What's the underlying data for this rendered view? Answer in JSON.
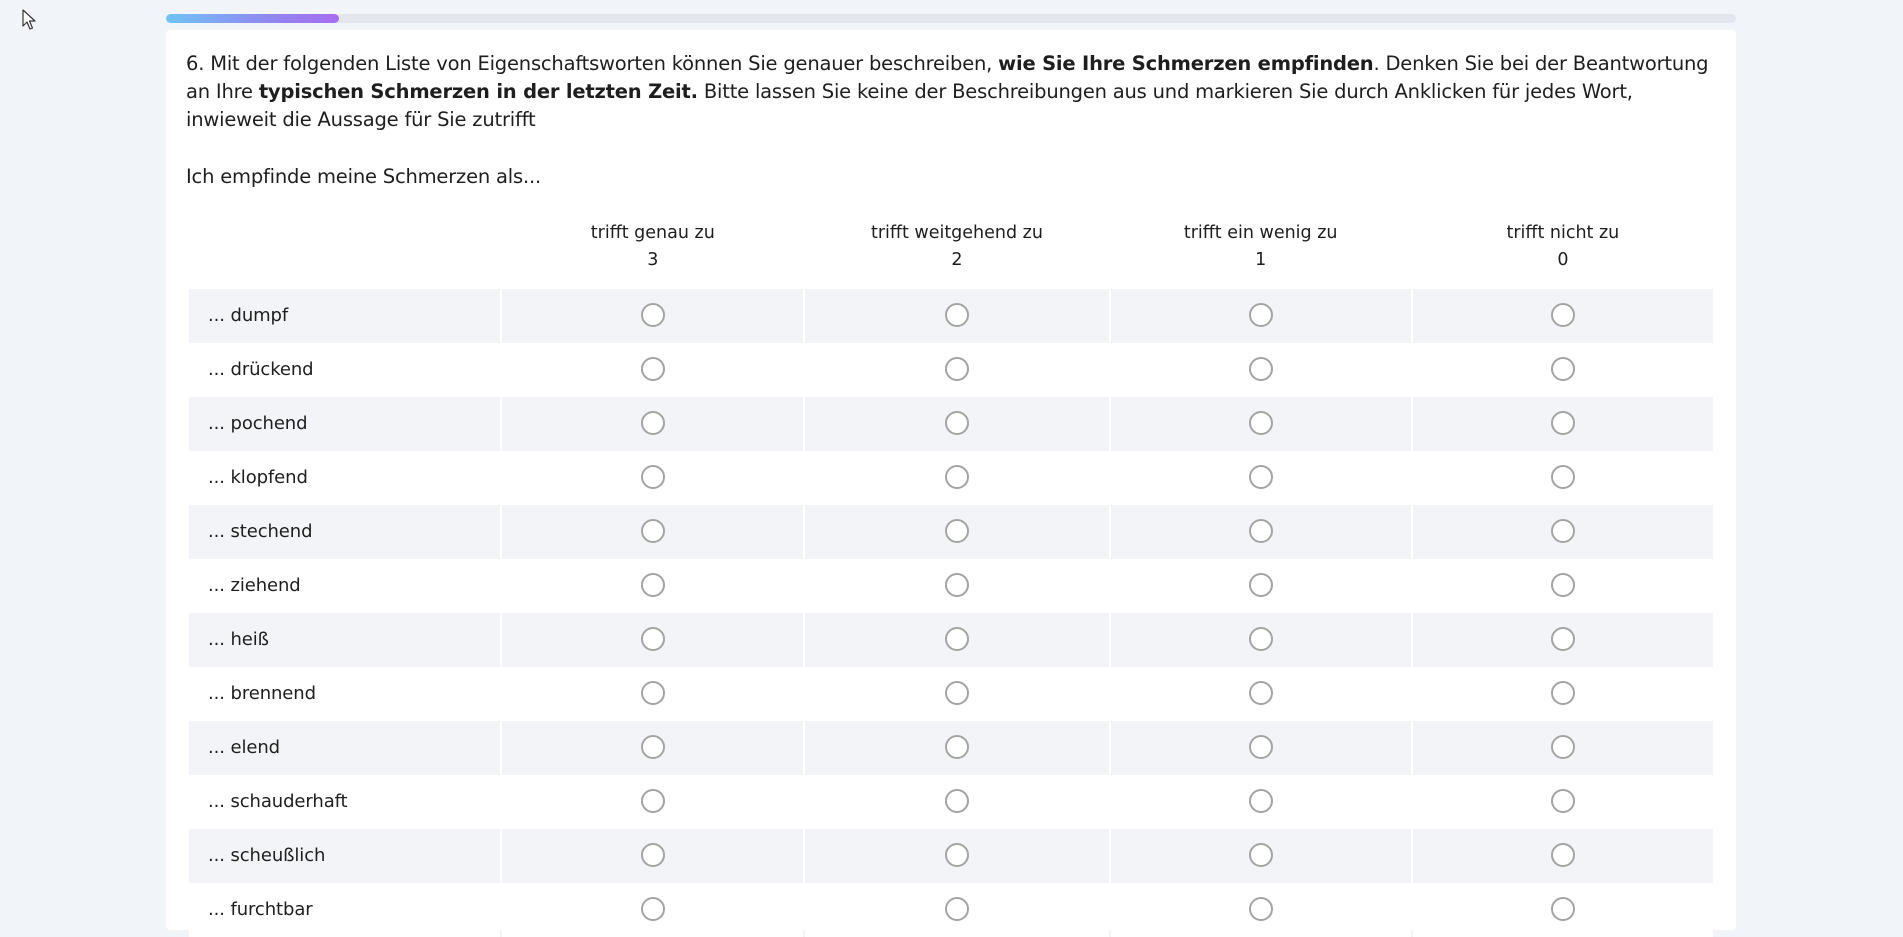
{
  "progress": {
    "percent": 11
  },
  "question": {
    "part1": "6. Mit der folgenden Liste von Eigenschaftsworten können Sie genauer beschreiben, ",
    "bold1": "wie Sie Ihre Schmerzen empfinden",
    "part2": ". Denken Sie bei der Beantwortung an Ihre ",
    "bold2": "typischen Schmerzen in der letzten Zeit.",
    "part3": " Bitte lassen Sie keine der Beschreibungen aus und markieren Sie durch Anklicken für jedes Wort, inwieweit die Aussage für Sie zutrifft",
    "lead": "Ich empfinde meine Schmerzen als..."
  },
  "columns": [
    {
      "label": "trifft genau zu",
      "value": "3"
    },
    {
      "label": "trifft weitgehend zu",
      "value": "2"
    },
    {
      "label": "trifft ein wenig zu",
      "value": "1"
    },
    {
      "label": "trifft nicht zu",
      "value": "0"
    }
  ],
  "rows": [
    {
      "label": "... dumpf"
    },
    {
      "label": "... drückend"
    },
    {
      "label": "... pochend"
    },
    {
      "label": "... klopfend"
    },
    {
      "label": "... stechend"
    },
    {
      "label": "... ziehend"
    },
    {
      "label": "... heiß"
    },
    {
      "label": "... brennend"
    },
    {
      "label": "... elend"
    },
    {
      "label": "... schauderhaft"
    },
    {
      "label": "... scheußlich"
    },
    {
      "label": "... furchtbar"
    }
  ],
  "icons": {
    "cursor": "mouse-pointer-icon",
    "radio": "radio-empty-icon"
  },
  "colors": {
    "background": "#f1f4f8",
    "progress_start": "#6fc3f5",
    "progress_end": "#a76cf0",
    "stripe": "#f2f4f7",
    "radio_border": "#a4a4a4"
  }
}
